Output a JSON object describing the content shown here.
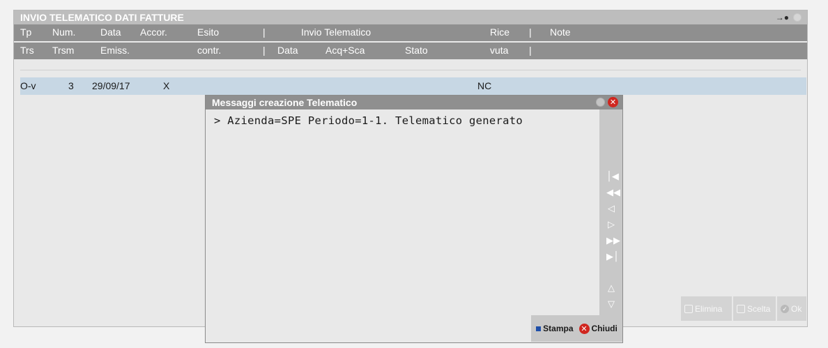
{
  "window": {
    "title": "INVIO TELEMATICO DATI FATTURE",
    "icons": [
      "pin-icon",
      "window-dot-icon"
    ]
  },
  "header_row1": [
    "Tp",
    "Num.",
    "Data",
    "Accor.",
    "Esito",
    "|",
    "Invio Telematico",
    "Rice",
    "|",
    "Note"
  ],
  "header_row2": [
    "Trs",
    "Trsm",
    "Emiss.",
    "contr.",
    "|",
    "Data",
    "Acq+Sca",
    "Stato",
    "vuta",
    "|"
  ],
  "rows": [
    {
      "tp": "O-v",
      "num": "3",
      "data": "29/09/17",
      "accor": "X",
      "ricevuta": "NC"
    }
  ],
  "actions": {
    "elimina": "Elimina",
    "scelta": "Scelta",
    "ok": "Ok"
  },
  "dialog": {
    "title": "Messaggi creazione Telematico",
    "message": "> Azienda=SPE Periodo=1-1. Telematico generato",
    "nav_icons": [
      "first-page-icon",
      "fast-rewind-icon",
      "previous-icon",
      "next-icon",
      "fast-forward-icon",
      "last-page-icon",
      "scroll-top-icon",
      "scroll-bottom-icon"
    ],
    "stampa_label": "Stampa",
    "chiudi_label": "Chiudi"
  },
  "colors": {
    "title_bar": "#bdbdbd",
    "header_bar": "#8f8f8f",
    "selected_row": "#c7d7e4",
    "close_red": "#d0261f",
    "stampa_blue": "#1f4fa8"
  }
}
